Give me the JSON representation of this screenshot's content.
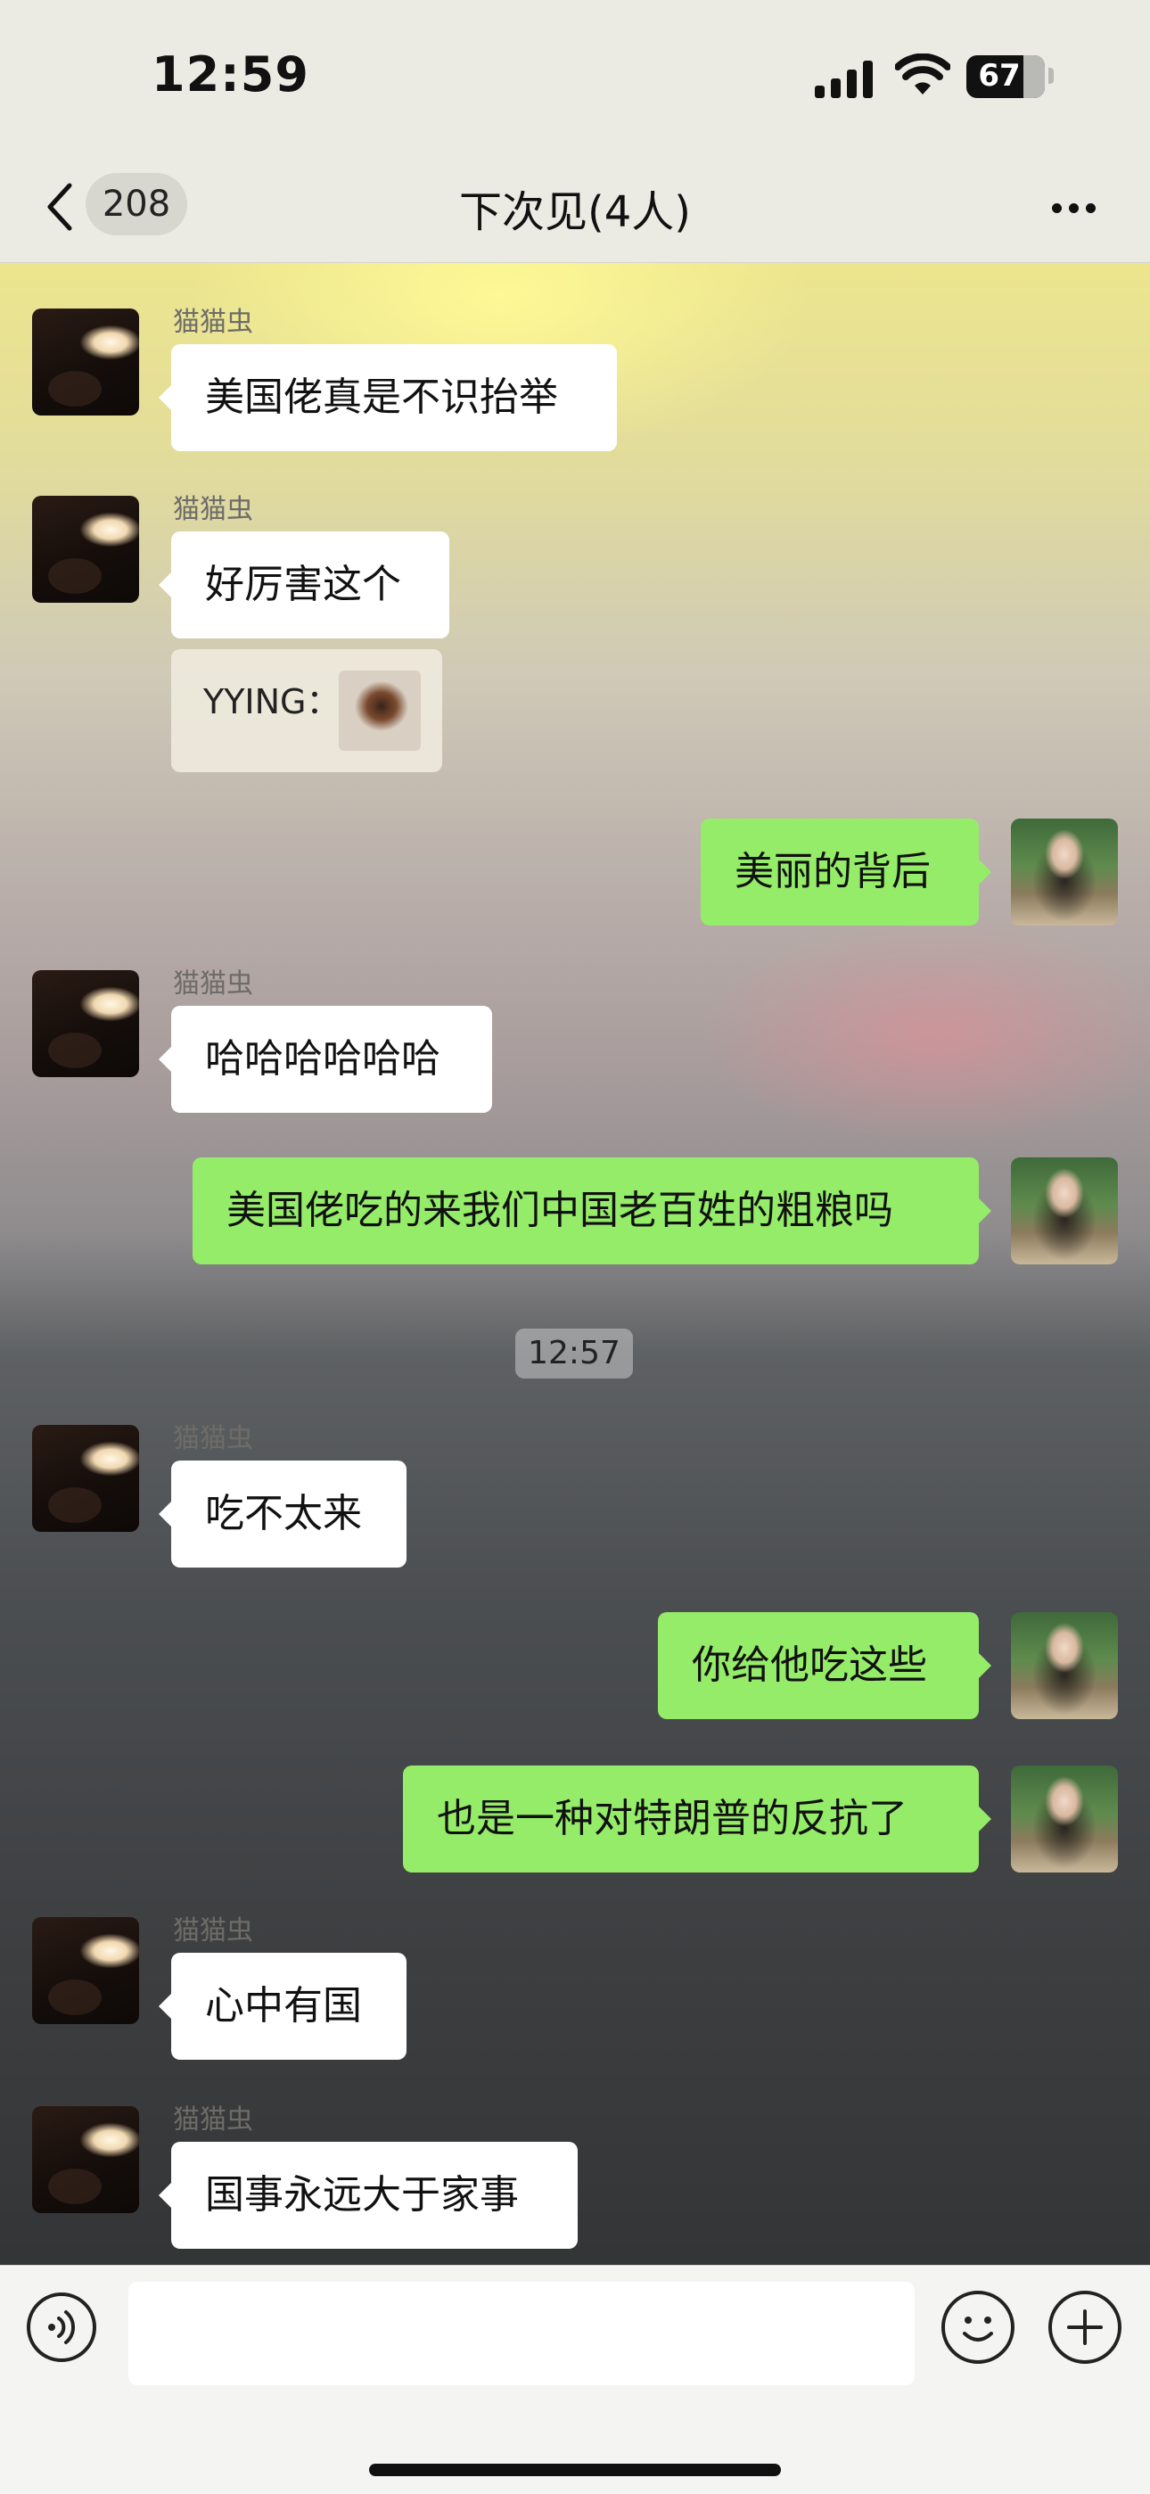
{
  "status_bar": {
    "time": "12:59",
    "battery": "67"
  },
  "nav": {
    "badge": "208",
    "title": "下次见(4人)"
  },
  "messages": [
    {
      "sender": "猫猫虫",
      "text": "美国佬真是不识抬举"
    },
    {
      "sender": "猫猫虫",
      "text": "好厉害这个"
    },
    {
      "quote_text": "YYING："
    },
    {
      "text": "美丽的背后"
    },
    {
      "sender": "猫猫虫",
      "text": "哈哈哈哈哈哈"
    },
    {
      "text": "美国佬吃的来我们中国老百姓的粗粮吗"
    },
    {
      "timestamp": "12:57"
    },
    {
      "sender": "猫猫虫",
      "text": "吃不太来"
    },
    {
      "text": "你给他吃这些"
    },
    {
      "text": "也是一种对特朗普的反抗了"
    },
    {
      "sender": "猫猫虫",
      "text": "心中有国"
    },
    {
      "sender": "猫猫虫",
      "text": "国事永远大于家事"
    }
  ],
  "input": {
    "value": ""
  },
  "colors": {
    "outgoing_bubble": "#95ec69",
    "incoming_bubble": "#ffffff",
    "bars": "#ecebe3"
  },
  "icons": [
    "back-chevron-icon",
    "more-icon",
    "voice-icon",
    "emoji-icon",
    "plus-icon",
    "signal-icon",
    "wifi-icon",
    "battery-icon"
  ]
}
